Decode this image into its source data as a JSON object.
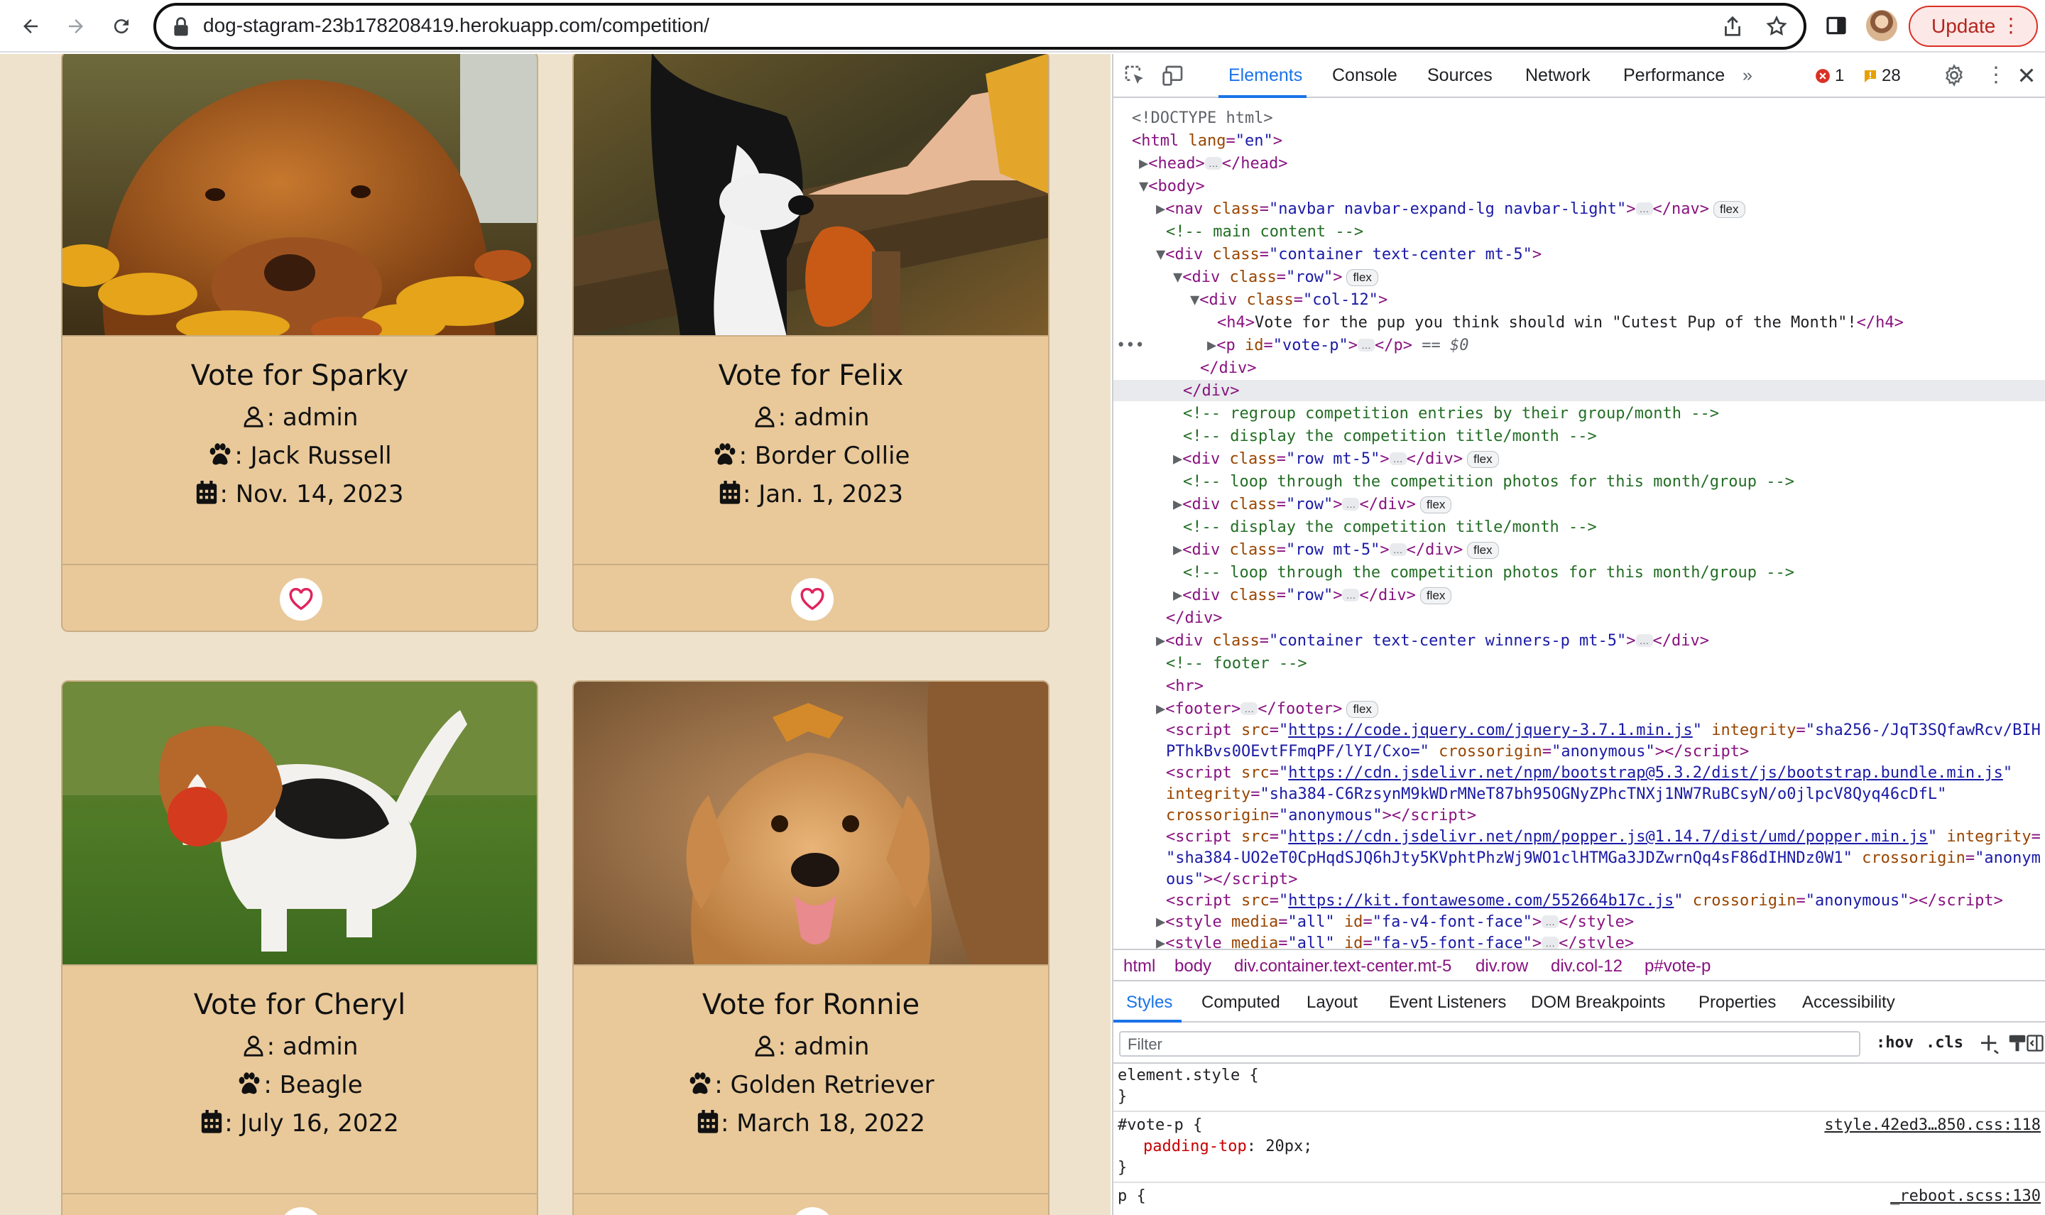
{
  "browser": {
    "url_host": "dog-stagram-23b178208419.herokuapp.com",
    "url_path": "/competition/",
    "update_label": "Update"
  },
  "cards": [
    {
      "title": "Vote for Sparky",
      "owner": ": admin",
      "breed": ": Jack Russell",
      "date": ": Nov. 14, 2023"
    },
    {
      "title": "Vote for Felix",
      "owner": ": admin",
      "breed": ": Border Collie",
      "date": ": Jan. 1, 2023"
    },
    {
      "title": "Vote for Cheryl",
      "owner": ": admin",
      "breed": ": Beagle",
      "date": ": July 16, 2022"
    },
    {
      "title": "Vote for Ronnie",
      "owner": ": admin",
      "breed": ": Golden Retriever",
      "date": ": March 18, 2022"
    }
  ],
  "devtools": {
    "tabs": [
      "Elements",
      "Console",
      "Sources",
      "Network",
      "Performance"
    ],
    "error_count": "1",
    "warning_count": "28",
    "breadcrumb": [
      "html",
      "body",
      "div.container.text-center.mt-5",
      "div.row",
      "div.col-12",
      "p#vote-p"
    ],
    "sub_tabs": [
      "Styles",
      "Computed",
      "Layout",
      "Event Listeners",
      "DOM Breakpoints",
      "Properties",
      "Accessibility"
    ],
    "filter_placeholder": "Filter",
    "hov": ":hov",
    "cls": ".cls",
    "h4_text": "Vote for the pup you think should win \"Cutest Pup of the Month\"!",
    "styles": {
      "element_style": "element.style {",
      "close": "}",
      "rule1_selector": "#vote-p {",
      "rule1_prop": "padding-top",
      "rule1_val": "20px;",
      "rule1_src": "style.42ed3…850.css:118",
      "rule2_selector": "p {",
      "rule2_src": "_reboot.scss:130"
    }
  },
  "colors": {
    "page_bg": "#eee2cc",
    "card_bg": "#e9c99a",
    "accent": "#1a73e8",
    "heart": "#e0245e"
  }
}
